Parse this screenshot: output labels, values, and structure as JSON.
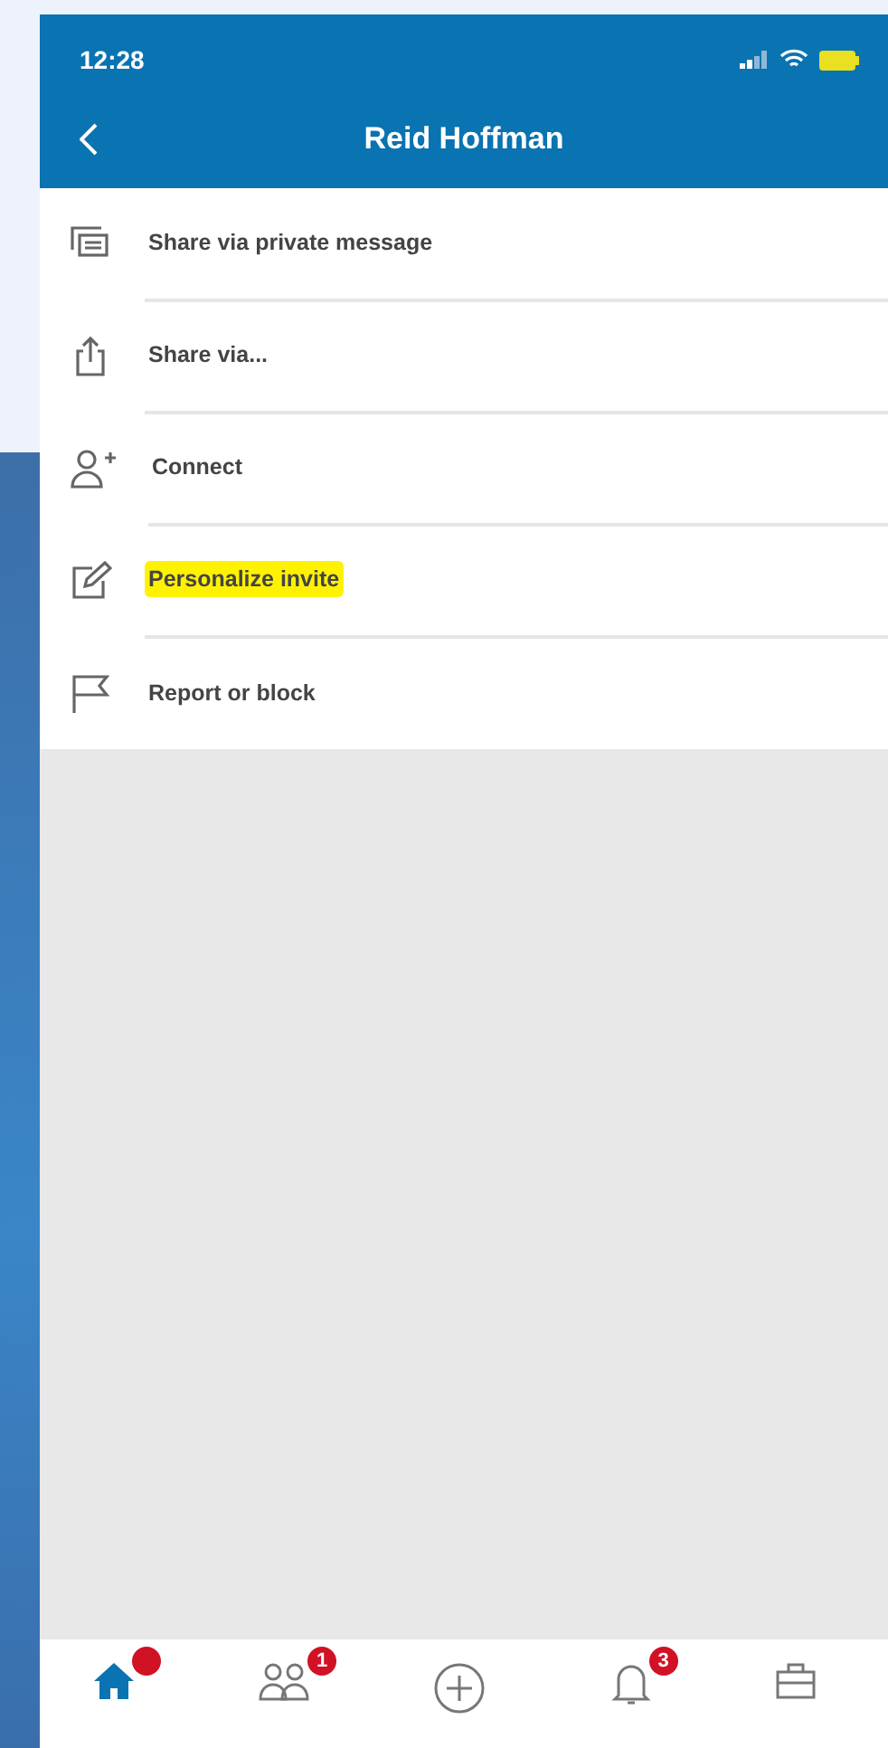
{
  "status_bar": {
    "time": "12:28"
  },
  "header": {
    "title": "Reid Hoffman"
  },
  "menu": [
    {
      "kind": "message",
      "label": "Share via private message",
      "highlighted": false
    },
    {
      "kind": "share",
      "label": "Share via...",
      "highlighted": false
    },
    {
      "kind": "connect",
      "label": "Connect",
      "highlighted": false
    },
    {
      "kind": "edit",
      "label": "Personalize invite",
      "highlighted": true
    },
    {
      "kind": "flag",
      "label": "Report or block",
      "highlighted": false
    }
  ],
  "tab_bar": [
    {
      "kind": "home",
      "selected": true,
      "dot": true
    },
    {
      "kind": "network",
      "selected": false,
      "badge": "1"
    },
    {
      "kind": "post",
      "selected": false
    },
    {
      "kind": "notifications",
      "selected": false,
      "badge": "3"
    },
    {
      "kind": "jobs",
      "selected": false
    }
  ]
}
